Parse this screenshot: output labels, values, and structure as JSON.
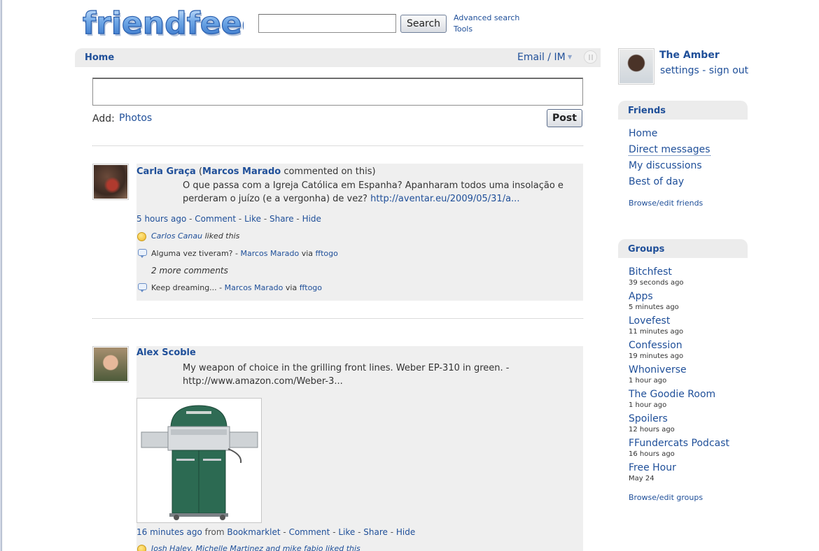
{
  "header": {
    "logo_text": "friendfeed",
    "search_button": "Search",
    "advanced_search": "Advanced search",
    "tools": "Tools"
  },
  "homebar": {
    "home": "Home",
    "email_im": "Email / IM"
  },
  "composer": {
    "add_label": "Add:",
    "photos": "Photos",
    "post_button": "Post"
  },
  "entries": [
    {
      "author": "Carla Graça",
      "paren_open": "(",
      "commenter": "Marcos Marado",
      "commented_suffix": "commented on this)",
      "text_line1": "O que passa com a Igreja Católica em Espanha? Apanharam todos uma insolação e",
      "text_line2": "perderam o juízo (e a vergonha) de vez?",
      "link": "http://aventar.eu/2009/05/31/a...",
      "time": "5 hours ago",
      "actions": [
        "Comment",
        "Like",
        "Share",
        "Hide"
      ],
      "sep": " - ",
      "like_user": "Carlos Canau",
      "like_suffix": "liked this",
      "comment1_text": "Alguma vez tiveram? -",
      "comment1_user": "Marcos Marado",
      "via": "via",
      "comment1_source": "fftogo",
      "more_comments": "2 more comments",
      "comment2_text": "Keep dreaming... -",
      "comment2_user": "Marcos Marado",
      "comment2_source": "fftogo"
    },
    {
      "author": "Alex Scoble",
      "text_line1": "My weapon of choice in the grilling front lines. Weber EP-310 in green. -",
      "link": "http://www.amazon.com/Weber-3...",
      "time": "16 minutes ago",
      "from_label": "from",
      "source": "Bookmarklet",
      "actions": [
        "Comment",
        "Like",
        "Share",
        "Hide"
      ],
      "likes_partial": "Josh Haley, Michelle Martinez and mike fabio liked this"
    }
  ],
  "sidebar": {
    "profile_name": "The Amber",
    "settings": "settings",
    "dash": " - ",
    "sign_out": "sign out",
    "friends_header": "Friends",
    "friends_links": [
      "Home",
      "Direct messages",
      "My discussions",
      "Best of day"
    ],
    "browse_friends": "Browse/edit friends",
    "groups_header": "Groups",
    "groups": [
      {
        "name": "Bitchfest",
        "time": "39 seconds ago"
      },
      {
        "name": "Apps",
        "time": "5 minutes ago"
      },
      {
        "name": "Lovefest",
        "time": "11 minutes ago"
      },
      {
        "name": "Confession",
        "time": "19 minutes ago"
      },
      {
        "name": "Whoniverse",
        "time": "1 hour ago"
      },
      {
        "name": "The Goodie Room",
        "time": "1 hour ago"
      },
      {
        "name": "Spoilers",
        "time": "12 hours ago"
      },
      {
        "name": "FFundercats Podcast",
        "time": "16 hours ago"
      },
      {
        "name": "Free Hour",
        "time": "May 24"
      }
    ],
    "browse_groups": "Browse/edit groups"
  }
}
